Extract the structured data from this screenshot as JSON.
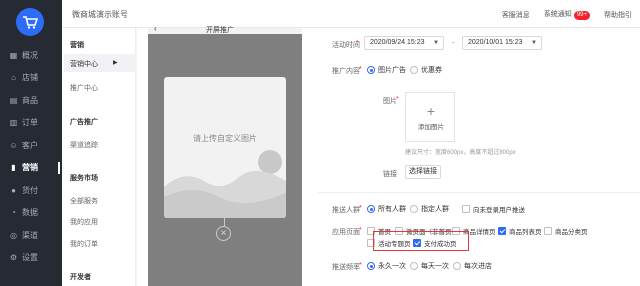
{
  "nav": {
    "items": [
      {
        "label": "概况",
        "icon": "dashboard-icon",
        "glyph": "▦"
      },
      {
        "label": "店铺",
        "icon": "store-icon",
        "glyph": "⌂"
      },
      {
        "label": "商品",
        "icon": "goods-icon",
        "glyph": "▤"
      },
      {
        "label": "订单",
        "icon": "order-icon",
        "glyph": "▥"
      },
      {
        "label": "客户",
        "icon": "customer-icon",
        "glyph": "☺"
      },
      {
        "label": "营销",
        "icon": "marketing-icon",
        "glyph": "▮"
      },
      {
        "label": "货付",
        "icon": "payment-icon",
        "glyph": "●"
      },
      {
        "label": "数据",
        "icon": "data-icon",
        "glyph": "◔"
      },
      {
        "label": "渠道",
        "icon": "channel-icon",
        "glyph": "◎"
      },
      {
        "label": "设置",
        "icon": "settings-icon",
        "glyph": "⚙"
      }
    ],
    "active": "营销"
  },
  "topbar": {
    "shop_name": "微商城演示账号",
    "customer_msg": "客服消息",
    "system_notice": "系统通知",
    "notice_badge": "99+",
    "help": "帮助指引"
  },
  "subnav": {
    "sec_marketing": "营销",
    "marketing_center": "营销中心",
    "promo_center": "推广中心",
    "sec_ads": "广告推广",
    "traffic": "渠道追踪",
    "sec_service": "服务市场",
    "all_services": "全部服务",
    "my_apps": "我的应用",
    "my_orders": "我的订单",
    "sec_dev": "开发者"
  },
  "preview": {
    "title": "开屏推广",
    "placeholder": "请上传自定义图片"
  },
  "form": {
    "time_label": "活动时间",
    "start": "2020/09/24 15:23",
    "end": "2020/10/01 15:23",
    "dash": "-",
    "content_label": "推广内容",
    "content_opt1": "图片广告",
    "content_opt2": "优惠券",
    "image_label": "图片",
    "add_image": "添加图片",
    "size_hint": "建议尺寸：宽度600px，高度不超过800px",
    "link_label": "链接",
    "link_button": "选择链接",
    "audience_label": "推送人群",
    "audience_opt1": "所有人群",
    "audience_opt2": "指定人群",
    "audience_opt3": "向未登录用户推送",
    "pages_label": "应用页面",
    "pages": [
      "首页",
      "微页面（非首页）",
      "商品详情页",
      "商品列表页",
      "商品分类页",
      "活动专题页",
      "支付成功页"
    ],
    "freq_label": "推送频率",
    "freq_opt1": "永久一次",
    "freq_opt2": "每天一次",
    "freq_opt3": "每次进店"
  }
}
